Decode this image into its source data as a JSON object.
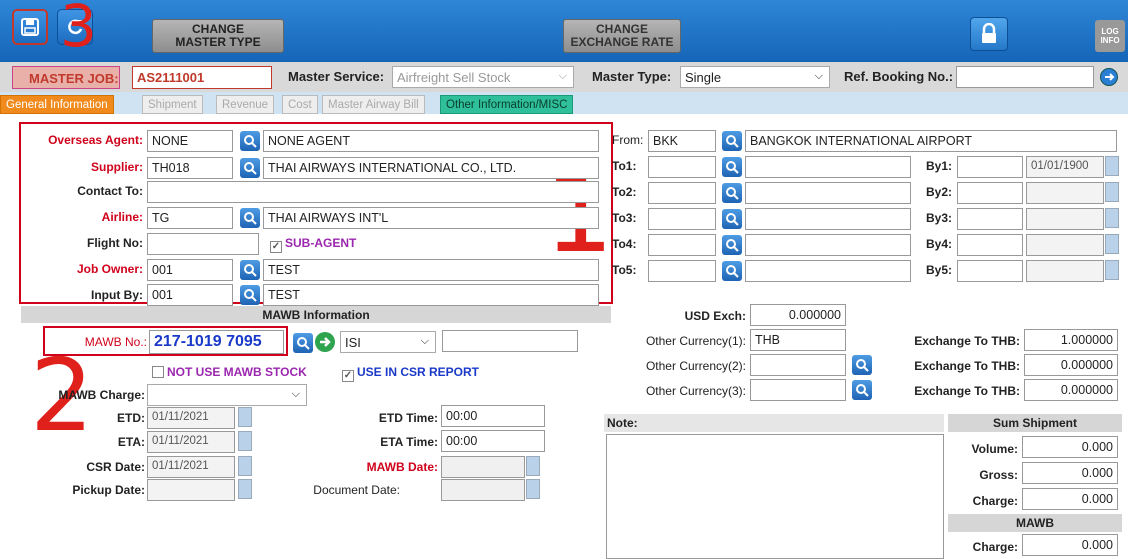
{
  "toolbar": {
    "change_master_type_line1": "CHANGE",
    "change_master_type_line2": "MASTER TYPE",
    "change_rate_line1": "CHANGE",
    "change_rate_line2": "EXCHANGE RATE",
    "log_line1": "LOG",
    "log_line2": "INFO",
    "annotation": "3"
  },
  "master": {
    "job_label": "MASTER JOB:",
    "job_value": "AS2111001",
    "service_label": "Master Service:",
    "service_value": "Airfreight Sell Stock",
    "type_label": "Master Type:",
    "type_value": "Single",
    "booking_label": "Ref. Booking No.:",
    "booking_value": ""
  },
  "tabs": [
    {
      "label": "General Information"
    },
    {
      "label": "Shipment"
    },
    {
      "label": "Revenue"
    },
    {
      "label": "Cost"
    },
    {
      "label": "Master Airway Bill"
    },
    {
      "label": "Other Information/MISC"
    }
  ],
  "left": {
    "overseas_agent_label": "Overseas Agent:",
    "overseas_agent_code": "NONE",
    "overseas_agent_name": "NONE AGENT",
    "supplier_label": "Supplier:",
    "supplier_code": "TH018",
    "supplier_name": "THAI AIRWAYS INTERNATIONAL CO., LTD.",
    "contact_label": "Contact To:",
    "contact_value": "",
    "airline_label": "Airline:",
    "airline_code": "TG",
    "airline_name": "THAI AIRWAYS INT'L",
    "flight_label": "Flight No:",
    "flight_value": "",
    "subagent_label": "SUB-AGENT",
    "job_owner_label": "Job Owner:",
    "job_owner_code": "001",
    "job_owner_name": "TEST",
    "input_by_label": "Input By:",
    "input_by_code": "001",
    "input_by_name": "TEST",
    "annotation": "1"
  },
  "mawb": {
    "section_title": "MAWB Information",
    "mawb_no_label": "MAWB No.:",
    "mawb_no_value": "217-1019 7095",
    "carrier_select": "ISI",
    "extra_value": "",
    "not_use_stock_label": "NOT USE MAWB STOCK",
    "use_csr_label": "USE IN CSR REPORT",
    "charge_label": "MAWB Charge:",
    "charge_value": "",
    "etd_label": "ETD:",
    "etd_value": "01/11/2021",
    "eta_label": "ETA:",
    "eta_value": "01/11/2021",
    "csr_label": "CSR Date:",
    "csr_value": "01/11/2021",
    "pickup_label": "Pickup Date:",
    "pickup_value": "",
    "etd_time_label": "ETD Time:",
    "etd_time_value": "00:00",
    "eta_time_label": "ETA Time:",
    "eta_time_value": "00:00",
    "mawb_date_label": "MAWB Date:",
    "mawb_date_value": "",
    "document_date_label": "Document Date:",
    "document_date_value": "",
    "annotation": "2"
  },
  "route": {
    "from_label": "From:",
    "from_code": "BKK",
    "from_name": "BANGKOK INTERNATIONAL AIRPORT",
    "to_labels": [
      "To1:",
      "To2:",
      "To3:",
      "To4:",
      "To5:"
    ],
    "by_labels": [
      "By1:",
      "By2:",
      "By3:",
      "By4:",
      "By5:"
    ],
    "by1_date": "01/01/1900"
  },
  "currency": {
    "usd_label": "USD Exch:",
    "usd_value": "0.000000",
    "other1_label": "Other Currency(1):",
    "other1_value": "THB",
    "other2_label": "Other Currency(2):",
    "other2_value": "",
    "other3_label": "Other Currency(3):",
    "other3_value": "",
    "exch_label": "Exchange To THB:",
    "exch1": "1.000000",
    "exch2": "0.000000",
    "exch3": "0.000000"
  },
  "note": {
    "label": "Note:",
    "value": ""
  },
  "sum": {
    "title": "Sum Shipment",
    "volume_label": "Volume:",
    "volume_value": "0.000",
    "gross_label": "Gross:",
    "gross_value": "0.000",
    "charge_label": "Charge:",
    "charge_value": "0.000",
    "mawb_title": "MAWB",
    "mawb_charge_label": "Charge:",
    "mawb_charge_value": "0.000"
  }
}
